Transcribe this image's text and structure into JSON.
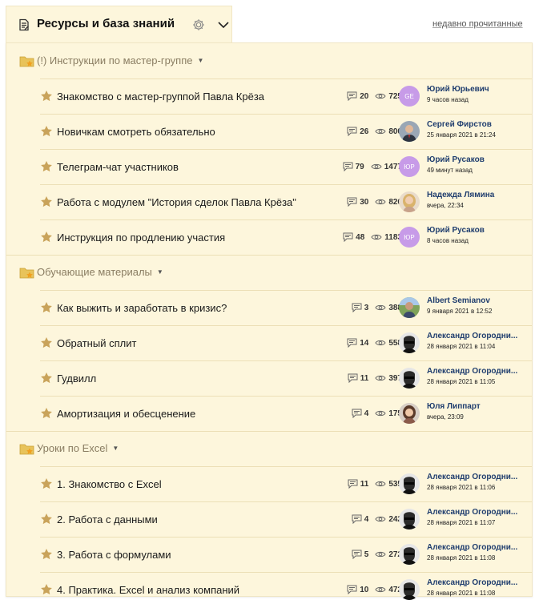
{
  "header": {
    "title": "Ресурсы и база знаний",
    "recent_link": "недавно прочитанные"
  },
  "colors": {
    "panel_bg": "#fdf6dc",
    "star": "#c9a35a",
    "author": "#1f3d6e",
    "group_text": "#8a7d62",
    "avatar_purple": "#c79be8"
  },
  "groups": [
    {
      "title": "(!) Инструкции по мастер-группе",
      "topics": [
        {
          "title": "Знакомство с мастер-группой Павла Крёза",
          "comments": "20",
          "views": "725",
          "avatar": {
            "type": "initials",
            "text": "GE"
          },
          "author": "Юрий Юрьевич",
          "time": "9 часов назад"
        },
        {
          "title": "Новичкам смотреть обязательно",
          "comments": "26",
          "views": "800",
          "avatar": {
            "type": "photo",
            "style": "man-suit"
          },
          "author": "Сергей Фирстов",
          "time": "25 января 2021 в 21:24"
        },
        {
          "title": "Телеграм-чат участников",
          "comments": "79",
          "views": "1477",
          "avatar": {
            "type": "initials",
            "text": "ЮР"
          },
          "author": "Юрий Русаков",
          "time": "49 минут назад"
        },
        {
          "title": "Работа с модулем \"История сделок Павла Крёза\"",
          "comments": "30",
          "views": "826",
          "avatar": {
            "type": "photo",
            "style": "woman-blonde"
          },
          "author": "Надежда Лямина",
          "time": "вчера, 22:34"
        },
        {
          "title": "Инструкция по продлению участия",
          "comments": "48",
          "views": "1183",
          "avatar": {
            "type": "initials",
            "text": "ЮР"
          },
          "author": "Юрий Русаков",
          "time": "8 часов назад"
        }
      ]
    },
    {
      "title": "Обучающие материалы",
      "topics": [
        {
          "title": "Как выжить и заработать в кризис?",
          "comments": "3",
          "views": "388",
          "avatar": {
            "type": "photo",
            "style": "man-outdoor"
          },
          "author": "Albert Semianov",
          "time": "9 января 2021 в 12:52"
        },
        {
          "title": "Обратный сплит",
          "comments": "14",
          "views": "558",
          "avatar": {
            "type": "photo",
            "style": "bw-sunglasses"
          },
          "author": "Александр Огородни...",
          "time": "28 января 2021 в 11:04"
        },
        {
          "title": "Гудвилл",
          "comments": "11",
          "views": "397",
          "avatar": {
            "type": "photo",
            "style": "bw-sunglasses"
          },
          "author": "Александр Огородни...",
          "time": "28 января 2021 в 11:05"
        },
        {
          "title": "Амортизация и обесценение",
          "comments": "4",
          "views": "175",
          "avatar": {
            "type": "photo",
            "style": "woman-dark"
          },
          "author": "Юля Липпарт",
          "time": "вчера, 23:09"
        }
      ]
    },
    {
      "title": "Уроки по Excel",
      "topics": [
        {
          "title": "1. Знакомство с Excel",
          "comments": "11",
          "views": "535",
          "avatar": {
            "type": "photo",
            "style": "bw-sunglasses"
          },
          "author": "Александр Огородни...",
          "time": "28 января 2021 в 11:06"
        },
        {
          "title": "2. Работа с данными",
          "comments": "4",
          "views": "242",
          "avatar": {
            "type": "photo",
            "style": "bw-sunglasses"
          },
          "author": "Александр Огородни...",
          "time": "28 января 2021 в 11:07"
        },
        {
          "title": "3. Работа с формулами",
          "comments": "5",
          "views": "272",
          "avatar": {
            "type": "photo",
            "style": "bw-sunglasses"
          },
          "author": "Александр Огородни...",
          "time": "28 января 2021 в 11:08"
        },
        {
          "title": "4. Практика. Excel и анализ компаний",
          "comments": "10",
          "views": "472",
          "avatar": {
            "type": "photo",
            "style": "bw-sunglasses"
          },
          "author": "Александр Огородни...",
          "time": "28 января 2021 в 11:08"
        }
      ]
    }
  ]
}
